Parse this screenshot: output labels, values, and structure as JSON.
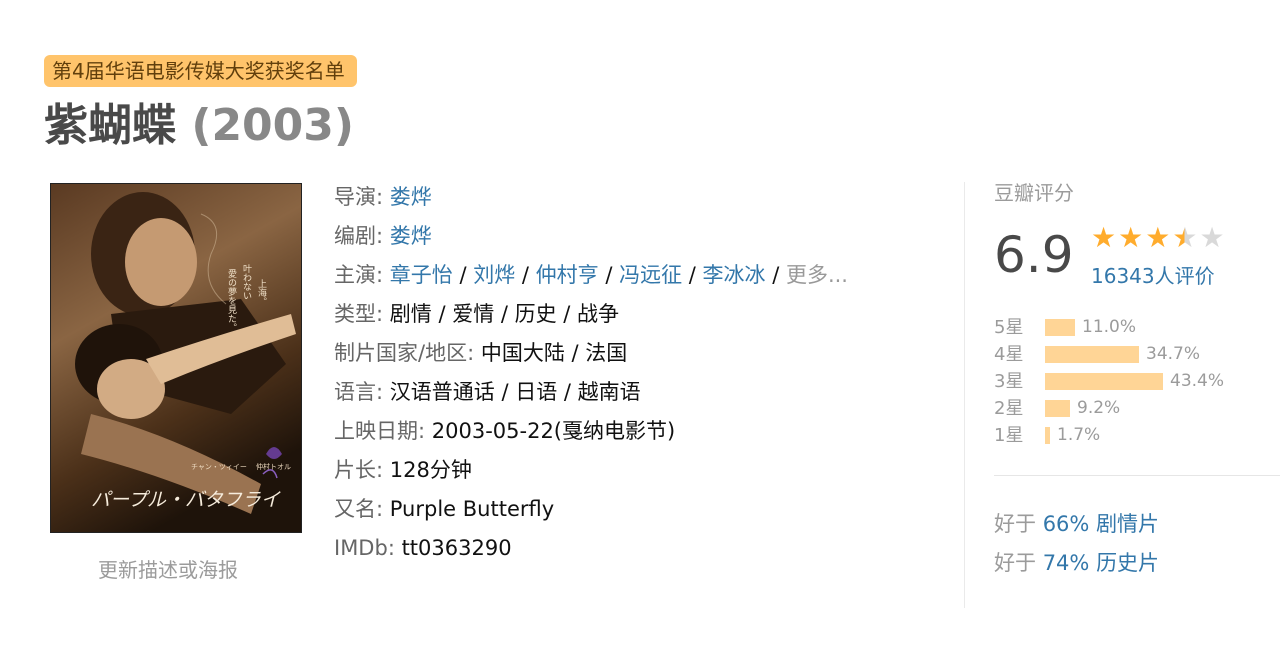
{
  "award_tag": "第4届华语电影传媒大奖获奖名单",
  "title": {
    "name": "紫蝴蝶",
    "year": "(2003)"
  },
  "poster": {
    "title_text": "パープル・バタフライ",
    "credit_left": "チャン・ツィイー",
    "credit_right": "仲村トオル",
    "tagline": "1928年、上海。叶わない愛の夢を見た。"
  },
  "update_link": "更新描述或海报",
  "info": {
    "director": {
      "label": "导演",
      "values": [
        "娄烨"
      ]
    },
    "writer": {
      "label": "编剧",
      "values": [
        "娄烨"
      ]
    },
    "cast": {
      "label": "主演",
      "values": [
        "章子怡",
        "刘烨",
        "仲村亨",
        "冯远征",
        "李冰冰"
      ],
      "more": "更多..."
    },
    "genre": {
      "label": "类型:",
      "value": "剧情 / 爱情 / 历史 / 战争"
    },
    "country": {
      "label": "制片国家/地区:",
      "value": "中国大陆 / 法国"
    },
    "language": {
      "label": "语言:",
      "value": "汉语普通话 / 日语 / 越南语"
    },
    "release": {
      "label": "上映日期:",
      "value": "2003-05-22(戛纳电影节)"
    },
    "runtime": {
      "label": "片长:",
      "value": "128分钟"
    },
    "aka": {
      "label": "又名:",
      "value": "Purple Butterfly"
    },
    "imdb": {
      "label": "IMDb:",
      "value": "tt0363290"
    }
  },
  "rating": {
    "title": "豆瓣评分",
    "score": "6.9",
    "stars_value": 3.5,
    "votes": "16343人评价",
    "distribution": [
      {
        "label": "5星",
        "percent": "11.0%",
        "value": 11.0
      },
      {
        "label": "4星",
        "percent": "34.7%",
        "value": 34.7
      },
      {
        "label": "3星",
        "percent": "43.4%",
        "value": 43.4
      },
      {
        "label": "2星",
        "percent": "9.2%",
        "value": 9.2
      },
      {
        "label": "1星",
        "percent": "1.7%",
        "value": 1.7
      }
    ],
    "better_than": [
      {
        "prefix": "好于",
        "percent": "66%",
        "genre": "剧情片"
      },
      {
        "prefix": "好于",
        "percent": "74%",
        "genre": "历史片"
      }
    ]
  },
  "colors": {
    "link": "#3377aa",
    "star": "#ffac2d",
    "star_empty": "#d9d9d9",
    "bar": "#ffd596",
    "tag_bg": "#ffc46b"
  }
}
